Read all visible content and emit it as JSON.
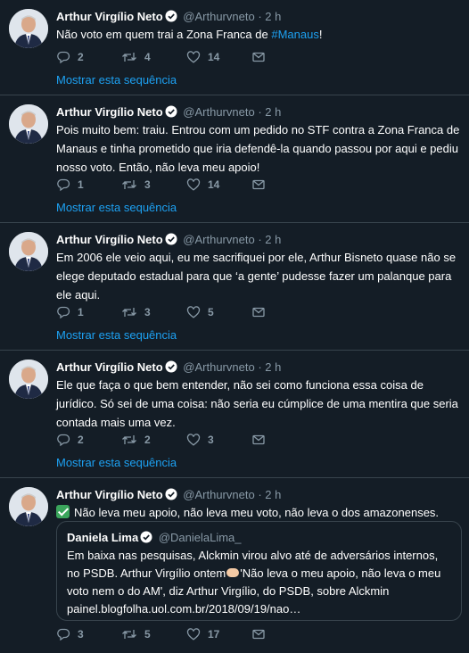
{
  "tweets": [
    {
      "name": "Arthur Virgílio Neto",
      "handle": "@Arthurvneto",
      "dot": "·",
      "time": "2 h",
      "text_before": "Não voto em quem trai a Zona Franca de ",
      "hashtag": "#Manaus",
      "text_after": "!",
      "replies": "2",
      "retweets": "4",
      "likes": "14",
      "thread_link": "Mostrar esta sequência"
    },
    {
      "name": "Arthur Virgílio Neto",
      "handle": "@Arthurvneto",
      "dot": "·",
      "time": "2 h",
      "text": "Pois muito bem: traiu. Entrou com um pedido no STF contra a Zona Franca de Manaus e tinha prometido que iria defendê-la quando passou por aqui e pediu nosso voto. Então, não leva meu apoio!",
      "replies": "1",
      "retweets": "3",
      "likes": "14",
      "thread_link": "Mostrar esta sequência"
    },
    {
      "name": "Arthur Virgílio Neto",
      "handle": "@Arthurvneto",
      "dot": "·",
      "time": "2 h",
      "text": "Em 2006 ele veio aqui, eu me sacrifiquei por ele, Arthur Bisneto quase não se elege deputado estadual para que ‘a gente’ pudesse fazer um palanque para ele aqui.",
      "replies": "1",
      "retweets": "3",
      "likes": "5",
      "thread_link": "Mostrar esta sequência"
    },
    {
      "name": "Arthur Virgílio Neto",
      "handle": "@Arthurvneto",
      "dot": "·",
      "time": "2 h",
      "text": "Ele que faça o que bem entender, não sei como funciona essa coisa de jurídico. Só sei de uma coisa: não seria eu cúmplice de uma mentira que seria contada mais uma vez.",
      "replies": "2",
      "retweets": "2",
      "likes": "3",
      "thread_link": "Mostrar esta sequência"
    },
    {
      "name": "Arthur Virgílio Neto",
      "handle": "@Arthurvneto",
      "dot": "·",
      "time": "2 h",
      "text": "Não leva meu apoio, não leva meu voto, não leva o dos amazonenses.",
      "replies": "3",
      "retweets": "5",
      "likes": "17",
      "quote": {
        "name": "Daniela Lima",
        "handle": "@DanielaLima_",
        "text_before": "Em baixa nas pesquisas, Alckmin virou alvo até de adversários internos, no PSDB. Arthur Virgílio ontem",
        "text_after": "'Não leva o meu apoio, não leva o meu voto nem o do AM', diz Arthur Virgílio, do PSDB, sobre Alckmin",
        "link": "painel.blogfolha.uol.com.br/2018/09/19/nao…"
      }
    }
  ],
  "colors": {
    "background": "#141d26",
    "link": "#1da1f2",
    "muted": "#8899a6",
    "divider": "#38444d"
  }
}
